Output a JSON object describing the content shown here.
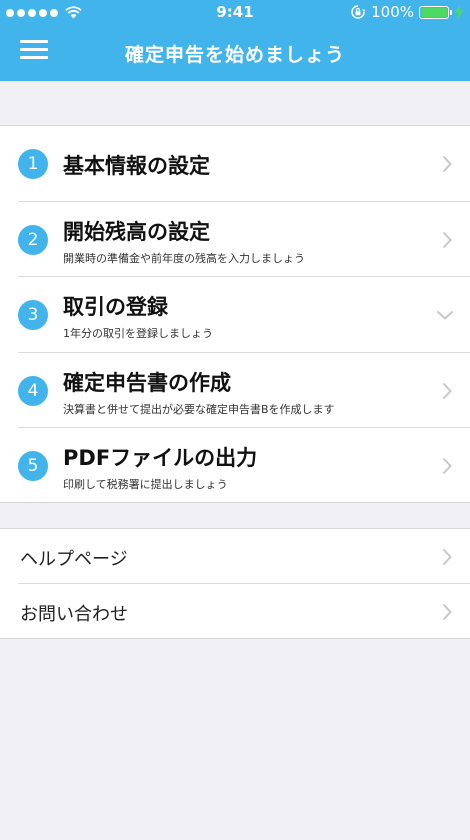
{
  "status_bar": {
    "time": "9:41",
    "battery": "100%"
  },
  "nav": {
    "title": "確定申告を始めましょう"
  },
  "steps": [
    {
      "number": "1",
      "title": "基本情報の設定",
      "subtitle": "",
      "chevron": "chevron-right-icon"
    },
    {
      "number": "2",
      "title": "開始残高の設定",
      "subtitle": "開業時の準備金や前年度の残高を入力しましょう",
      "chevron": "chevron-right-icon"
    },
    {
      "number": "3",
      "title": "取引の登録",
      "subtitle": "1年分の取引を登録しましょう",
      "chevron": "chevron-down-icon"
    },
    {
      "number": "4",
      "title": "確定申告書の作成",
      "subtitle": "決算書と併せて提出が必要な確定申告書Bを作成します",
      "chevron": "chevron-right-icon"
    },
    {
      "number": "5",
      "title": "PDFファイルの出力",
      "subtitle": "印刷して税務署に提出しましょう",
      "chevron": "chevron-right-icon"
    }
  ],
  "help_links": [
    {
      "label": "ヘルプページ"
    },
    {
      "label": "お問い合わせ"
    }
  ],
  "colors": {
    "accent": "#41b4ec",
    "battery": "#4cd964",
    "background": "#efeff4"
  }
}
